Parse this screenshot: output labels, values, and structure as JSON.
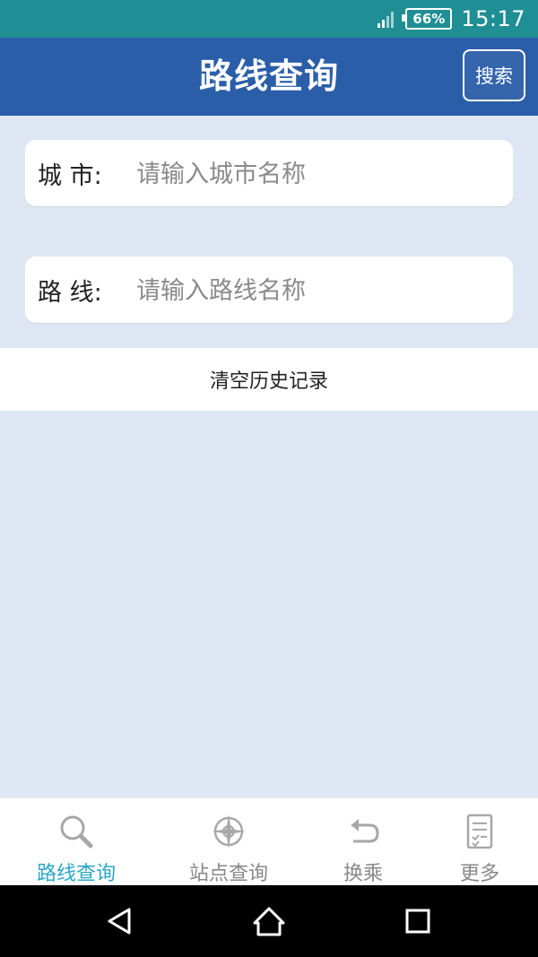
{
  "status_bar": {
    "battery": "66%",
    "time": "15:17"
  },
  "header": {
    "title": "路线查询",
    "search_button": "搜索"
  },
  "form": {
    "city": {
      "label": "城 市:",
      "placeholder": "请输入城市名称",
      "value": ""
    },
    "route": {
      "label": "路 线:",
      "placeholder": "请输入路线名称",
      "value": ""
    }
  },
  "clear_history": "清空历史记录",
  "tabs": [
    {
      "label": "路线查询",
      "icon": "search-icon",
      "active": true
    },
    {
      "label": "站点查询",
      "icon": "compass-icon",
      "active": false
    },
    {
      "label": "换乘",
      "icon": "return-arrow-icon",
      "active": false
    },
    {
      "label": "更多",
      "icon": "checklist-icon",
      "active": false
    }
  ],
  "system_nav": {
    "back": "back-icon",
    "home": "home-icon",
    "recents": "recents-icon"
  },
  "colors": {
    "status_bar": "#1f8f95",
    "header": "#2b5ea9",
    "background": "#dfe6f3",
    "active_tab": "#2aa8c6"
  }
}
